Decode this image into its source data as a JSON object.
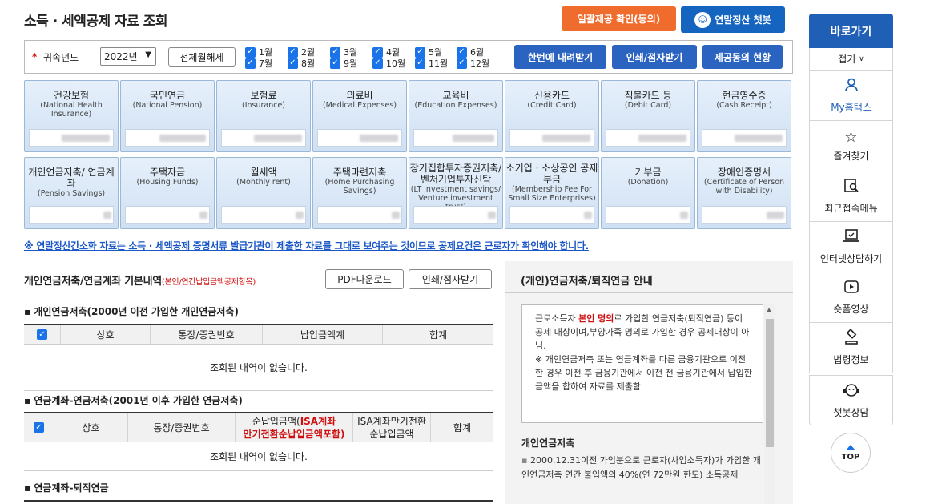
{
  "page_title": "소득 · 세액공제 자료 조회",
  "top_buttons": {
    "bulk_confirm": "일괄제공 확인(동의)",
    "chatbot": "연말정산 챗봇"
  },
  "filter": {
    "required_mark": "*",
    "year_label": "귀속년도",
    "year_value": "2022년",
    "deselect_all": "전체월해제",
    "months": [
      "1월",
      "2월",
      "3월",
      "4월",
      "5월",
      "6월",
      "7월",
      "8월",
      "9월",
      "10월",
      "11월",
      "12월"
    ],
    "download_all": "한번에 내려받기",
    "print_receive": "인쇄/점자받기",
    "consent_status": "제공동의 현황"
  },
  "categories": [
    {
      "kr": "건강보험",
      "en": "(National Health Insurance)"
    },
    {
      "kr": "국민연금",
      "en": "(National Pension)"
    },
    {
      "kr": "보험료",
      "en": "(Insurance)"
    },
    {
      "kr": "의료비",
      "en": "(Medical Expenses)"
    },
    {
      "kr": "교육비",
      "en": "(Education Expenses)"
    },
    {
      "kr": "신용카드",
      "en": "(Credit Card)"
    },
    {
      "kr": "직불카드 등",
      "en": "(Debit Card)"
    },
    {
      "kr": "현금영수증",
      "en": "(Cash Receipt)"
    },
    {
      "kr": "개인연금저축/ 연금계좌",
      "en": "(Pension Savings)"
    },
    {
      "kr": "주택자금",
      "en": "(Housing Funds)"
    },
    {
      "kr": "월세액",
      "en": "(Monthly rent)"
    },
    {
      "kr": "주택마련저축",
      "en": "(Home Purchasing Savings)"
    },
    {
      "kr": "장기집합투자증권저축/ 벤처기업투자신탁",
      "en": "(LT investment savings/ Venture investment trust)"
    },
    {
      "kr": "소기업 · 소상공인 공제부금",
      "en": "(Membership Fee For Small Size Enterprises)"
    },
    {
      "kr": "기부금",
      "en": "(Donation)"
    },
    {
      "kr": "장애인증명서",
      "en": "(Certificate of Person with Disability)"
    }
  ],
  "notice": "※ 연말정산간소화 자료는 소득 · 세액공제 증명서류 발급기관이 제출한 자료를 그대로 보여주는 것이므로 공제요건은 근로자가 확인해야 합니다.",
  "section": {
    "title": "개인연금저축/연금계좌 기본내역",
    "subtitle": "(본인/연간납입금액공제항목)",
    "pdf_download": "PDF다운로드",
    "print_receive": "인쇄/점자받기"
  },
  "table1": {
    "heading": "개인연금저축(2000년 이전 가입한 개인연금저축)",
    "columns": [
      "상호",
      "통장/증권번호",
      "납입금액계",
      "합계"
    ],
    "empty": "조회된 내역이 없습니다."
  },
  "table2": {
    "heading": "연금계좌-연금저축(2001년 이후 가입한 연금저축)",
    "columns": [
      "상호",
      "통장/증권번호",
      "순납입금액",
      "ISA계좌 만기전환순납입금액포함)",
      "ISA계좌만기전환 순납입금액",
      "합계"
    ],
    "col3_line1": "순납입금액(",
    "col3_red1": "ISA계좌",
    "col3_red2": "만기전환순납입금액포함)",
    "col4_line1": "ISA계좌만기전환",
    "col4_line2": "순납입금액",
    "empty": "조회된 내역이 없습니다."
  },
  "table3": {
    "heading": "연금계좌-퇴직연금"
  },
  "info": {
    "title": "(개인)연금저축/퇴직연금 안내",
    "p1_pre": "근로소득자 ",
    "p1_red": "본인 명의",
    "p1_post": "로 가입한 연금저축(퇴직연금) 등이 공제 대상이며,부양가족 명의로 가입한 경우 공제대상이 아님.",
    "p2": "※ 개인연금저축 또는 연금계좌를 다른 금융기관으로 이전한 경우 이전 후 금융기관에서 이전 전 금융기관에서 납입한 금액을 합하여 자료를 제출함",
    "sub_heading": "개인연금저축",
    "bullet1": "2000.12.31이전 가입분으로 근로자(사업소득자)가 가입한 개인연금저축 연간 불입액의 40%(연 72만원 한도) 소득공제"
  },
  "sidebar": {
    "header": "바로가기",
    "fold": "접기",
    "items": [
      {
        "label": "My홈택스",
        "icon": "user-icon"
      },
      {
        "label": "즐겨찾기",
        "icon": "star-icon"
      },
      {
        "label": "최근접속메뉴",
        "icon": "recent-search-icon"
      },
      {
        "label": "인터넷상담하기",
        "icon": "laptop-chat-icon"
      },
      {
        "label": "숏폼영상",
        "icon": "play-icon"
      },
      {
        "label": "법령정보",
        "icon": "gavel-icon"
      },
      {
        "label": "챗봇상담",
        "icon": "chatbot-icon"
      }
    ],
    "top": "TOP"
  }
}
